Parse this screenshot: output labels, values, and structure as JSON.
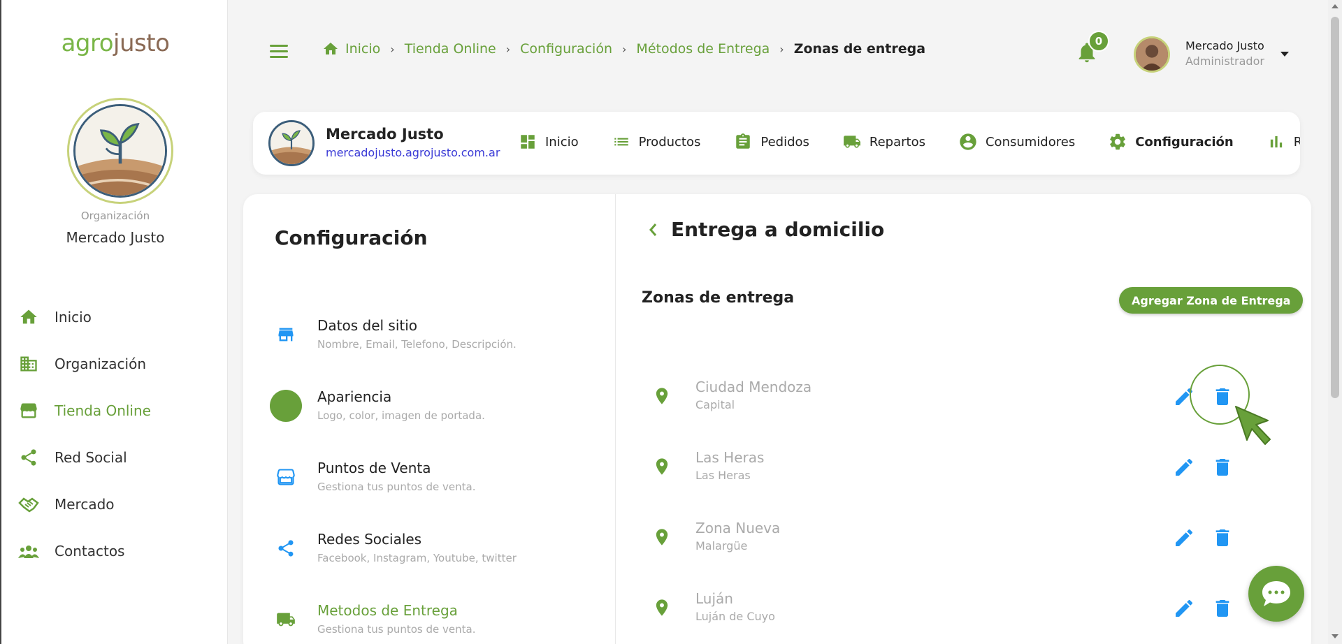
{
  "brand": {
    "logo_part1": "agro",
    "logo_part2": "justo"
  },
  "sidebar": {
    "org_caption": "Organización",
    "org_name": "Mercado Justo",
    "items": [
      {
        "label": "Inicio",
        "icon": "home-icon"
      },
      {
        "label": "Organización",
        "icon": "building-icon"
      },
      {
        "label": "Tienda Online",
        "icon": "store-icon",
        "active": true
      },
      {
        "label": "Red Social",
        "icon": "share-icon"
      },
      {
        "label": "Mercado",
        "icon": "handshake-icon"
      },
      {
        "label": "Contactos",
        "icon": "contacts-icon"
      }
    ]
  },
  "breadcrumb": {
    "items": [
      "Inicio",
      "Tienda Online",
      "Configuración",
      "Métodos de Entrega"
    ],
    "current": "Zonas de entrega"
  },
  "notifications": {
    "count": "0"
  },
  "user": {
    "name": "Mercado Justo",
    "role": "Administrador"
  },
  "store": {
    "name": "Mercado Justo",
    "url": "mercadojusto.agrojusto.com.ar",
    "tabs": [
      {
        "label": "Inicio",
        "icon": "dashboard-icon"
      },
      {
        "label": "Productos",
        "icon": "list-icon"
      },
      {
        "label": "Pedidos",
        "icon": "clipboard-icon"
      },
      {
        "label": "Repartos",
        "icon": "truck-icon"
      },
      {
        "label": "Consumidores",
        "icon": "user-circle-icon"
      },
      {
        "label": "Configuración",
        "icon": "gear-icon",
        "active": true
      },
      {
        "label": "Repo",
        "icon": "bar-chart-icon"
      }
    ]
  },
  "config": {
    "title": "Configuración",
    "items": [
      {
        "title": "Datos del sitio",
        "subtitle": "Nombre, Email, Telefono, Descripción.",
        "icon": "storefront-icon"
      },
      {
        "title": "Apariencia",
        "subtitle": "Logo, color, imagen de portada.",
        "icon": "color-circle-icon"
      },
      {
        "title": "Puntos de Venta",
        "subtitle": "Gestiona tus puntos de venta.",
        "icon": "shop-icon"
      },
      {
        "title": "Redes Sociales",
        "subtitle": "Facebook, Instagram, Youtube, twitter",
        "icon": "share-icon"
      },
      {
        "title": "Metodos de Entrega",
        "subtitle": "Gestiona tus puntos de venta.",
        "icon": "truck-icon",
        "active": true
      }
    ]
  },
  "detail": {
    "title": "Entrega a domicilio",
    "zones_title": "Zonas de entrega",
    "add_button": "Agregar Zona de Entrega",
    "zones": [
      {
        "name": "Ciudad Mendoza",
        "area": "Capital"
      },
      {
        "name": "Las Heras",
        "area": "Las Heras"
      },
      {
        "name": "Zona Nueva",
        "area": "Malargüe"
      },
      {
        "name": "Luján",
        "area": "Luján de Cuyo"
      }
    ]
  },
  "colors": {
    "brand_green": "#68a03a",
    "action_blue": "#2196f3",
    "link_blue": "#3a3ad6"
  }
}
